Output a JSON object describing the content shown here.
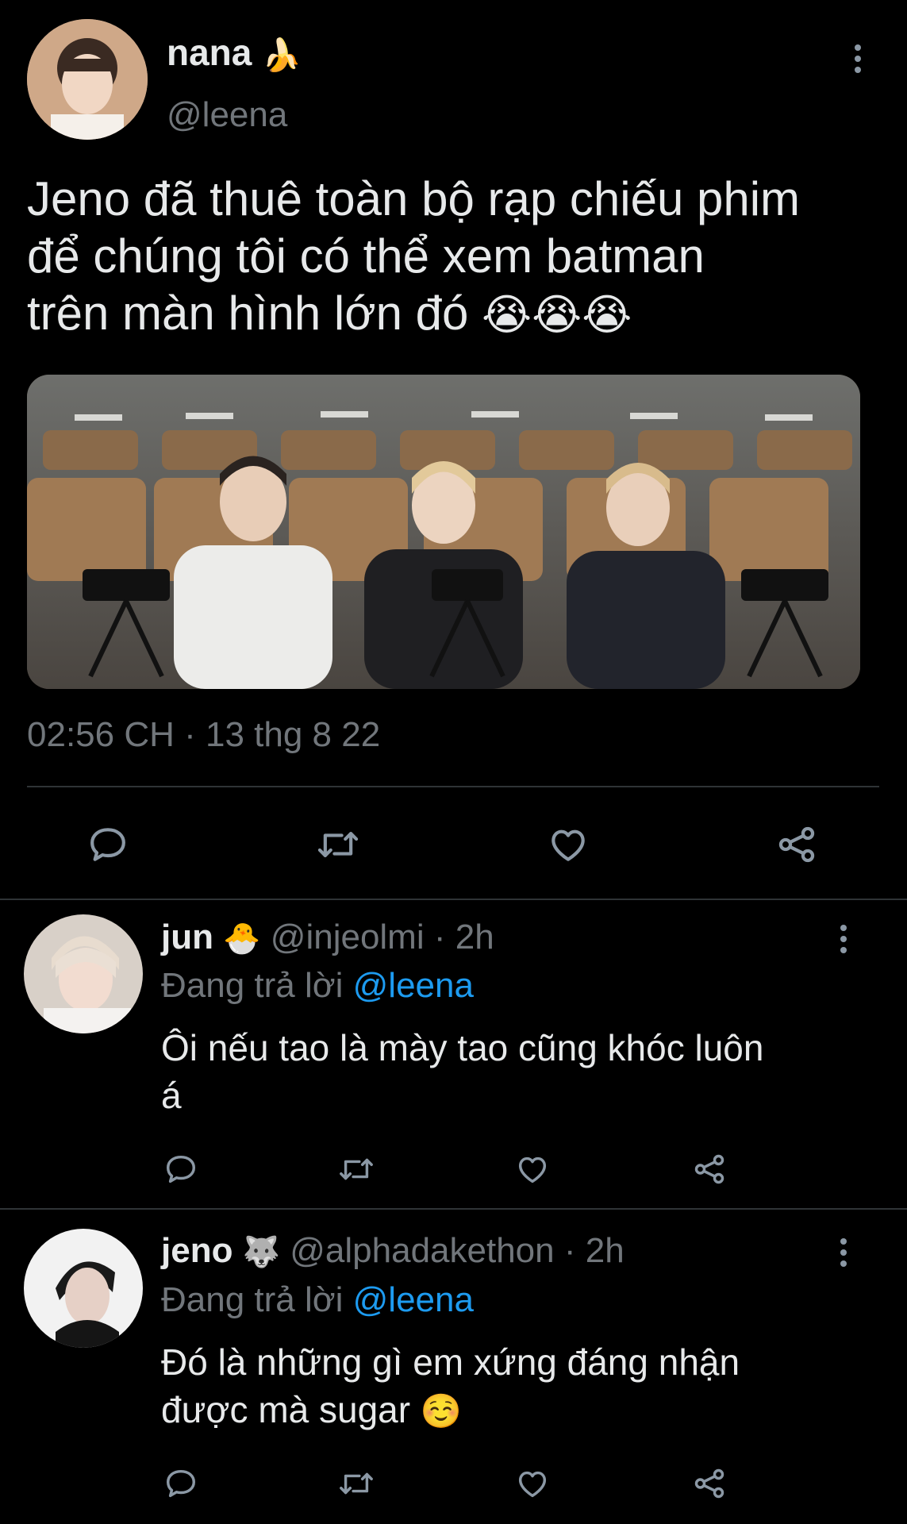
{
  "tweet": {
    "display_name": "nana",
    "name_emoji": "🍌",
    "handle": "@leena",
    "text_lines": [
      "Jeno đã thuê toàn bộ rạp chiếu phim",
      "để chúng tôi có thể xem batman",
      "trên màn hình lớn đó"
    ],
    "text_emojis": "😭😭😭",
    "timestamp": "02:56 CH · 13 thg 8 22"
  },
  "replies": [
    {
      "display_name": "jun",
      "name_emoji": "🐣",
      "handle": "@injeolmi",
      "age": "· 2h",
      "replying_prefix": "Đang trả lời",
      "replying_to": "@leena",
      "text_lines": [
        "Ôi nếu tao là mày tao cũng khóc luôn",
        "á"
      ]
    },
    {
      "display_name": "jeno",
      "name_emoji": "🐺",
      "handle": "@alphadakethon",
      "age": "· 2h",
      "replying_prefix": "Đang trả lời",
      "replying_to": "@leena",
      "text_lines": [
        "Đó là những gì em xứng đáng nhận",
        "được mà sugar"
      ],
      "text_emoji": "☺️"
    }
  ],
  "icons": [
    "reply-icon",
    "retweet-icon",
    "like-icon",
    "share-icon",
    "more-icon"
  ],
  "colors": {
    "background": "#000000",
    "text": "#e7e9ea",
    "muted": "#71767b",
    "link": "#1d9bf0",
    "divider": "#2f3336"
  }
}
